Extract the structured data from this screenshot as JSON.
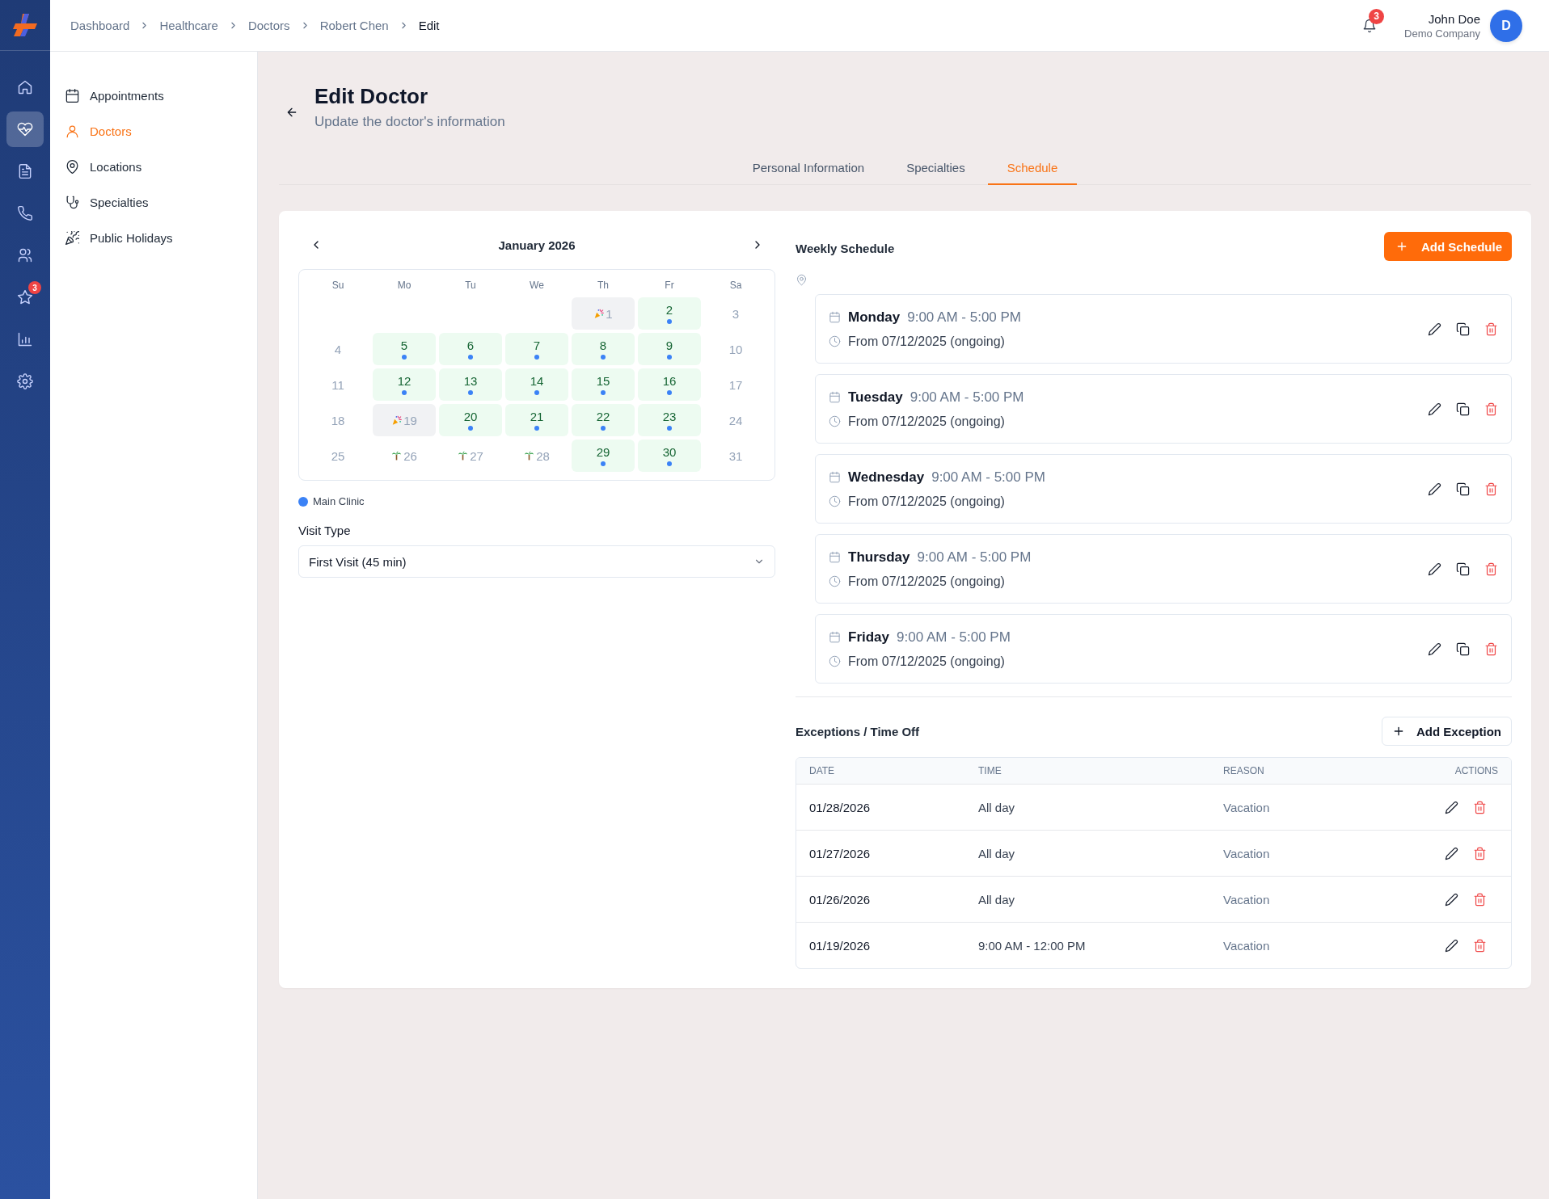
{
  "breadcrumbs": [
    {
      "label": "Dashboard",
      "current": false
    },
    {
      "label": "Healthcare",
      "current": false
    },
    {
      "label": "Doctors",
      "current": false
    },
    {
      "label": "Robert Chen",
      "current": false
    },
    {
      "label": "Edit",
      "current": true
    }
  ],
  "notifications": {
    "count": "3"
  },
  "user": {
    "name": "John Doe",
    "company": "Demo Company",
    "initial": "D"
  },
  "rail": [
    {
      "kind": "home",
      "selected": false
    },
    {
      "kind": "heart",
      "selected": true
    },
    {
      "kind": "document",
      "selected": false
    },
    {
      "kind": "phone",
      "selected": false
    },
    {
      "kind": "users",
      "selected": false
    },
    {
      "kind": "star",
      "selected": false,
      "badge": "3"
    },
    {
      "kind": "chart",
      "selected": false
    },
    {
      "kind": "settings",
      "selected": false
    }
  ],
  "sidebar": {
    "items": [
      {
        "label": "Appointments",
        "kind": "calendar",
        "selected": false
      },
      {
        "label": "Doctors",
        "kind": "person",
        "selected": true
      },
      {
        "label": "Locations",
        "kind": "pin",
        "selected": false
      },
      {
        "label": "Specialties",
        "kind": "stethoscope",
        "selected": false
      },
      {
        "label": "Public Holidays",
        "kind": "popper",
        "selected": false
      }
    ]
  },
  "page": {
    "title": "Edit Doctor",
    "subtitle": "Update the doctor's information"
  },
  "tabs": [
    {
      "label": "Personal Information",
      "selected": false
    },
    {
      "label": "Specialties",
      "selected": false
    },
    {
      "label": "Schedule",
      "selected": true
    }
  ],
  "calendar": {
    "month": "January 2026",
    "weekdays": [
      "Su",
      "Mo",
      "Tu",
      "We",
      "Th",
      "Fr",
      "Sa"
    ],
    "weeks": [
      [
        {
          "day": "1",
          "kind": "holiday"
        },
        {
          "day": "2",
          "kind": "available"
        },
        {
          "day": "3",
          "kind": "off"
        }
      ],
      [
        {
          "day": "4",
          "kind": "off"
        },
        {
          "day": "5",
          "kind": "available"
        },
        {
          "day": "6",
          "kind": "available"
        },
        {
          "day": "7",
          "kind": "available"
        },
        {
          "day": "8",
          "kind": "available"
        },
        {
          "day": "9",
          "kind": "available"
        },
        {
          "day": "10",
          "kind": "off"
        }
      ],
      [
        {
          "day": "11",
          "kind": "off"
        },
        {
          "day": "12",
          "kind": "available"
        },
        {
          "day": "13",
          "kind": "available"
        },
        {
          "day": "14",
          "kind": "available"
        },
        {
          "day": "15",
          "kind": "available"
        },
        {
          "day": "16",
          "kind": "available"
        },
        {
          "day": "17",
          "kind": "off"
        }
      ],
      [
        {
          "day": "18",
          "kind": "off"
        },
        {
          "day": "19",
          "kind": "holiday"
        },
        {
          "day": "20",
          "kind": "available"
        },
        {
          "day": "21",
          "kind": "available"
        },
        {
          "day": "22",
          "kind": "available"
        },
        {
          "day": "23",
          "kind": "available"
        },
        {
          "day": "24",
          "kind": "off"
        }
      ],
      [
        {
          "day": "25",
          "kind": "off"
        },
        {
          "day": "26",
          "kind": "vacation"
        },
        {
          "day": "27",
          "kind": "vacation"
        },
        {
          "day": "28",
          "kind": "vacation"
        },
        {
          "day": "29",
          "kind": "available"
        },
        {
          "day": "30",
          "kind": "available"
        },
        {
          "day": "31",
          "kind": "off"
        }
      ]
    ]
  },
  "legend": [
    {
      "label": "Main Clinic",
      "color": "#3b82f6"
    }
  ],
  "visit_type": {
    "label": "Visit Type",
    "value": "First Visit (45 min)"
  },
  "weekly_schedule": {
    "title": "Weekly Schedule",
    "add_button": "Add Schedule",
    "entries": [
      {
        "day": "Monday",
        "time": "9:00 AM - 5:00 PM",
        "period": "From 07/12/2025 (ongoing)"
      },
      {
        "day": "Tuesday",
        "time": "9:00 AM - 5:00 PM",
        "period": "From 07/12/2025 (ongoing)"
      },
      {
        "day": "Wednesday",
        "time": "9:00 AM - 5:00 PM",
        "period": "From 07/12/2025 (ongoing)"
      },
      {
        "day": "Thursday",
        "time": "9:00 AM - 5:00 PM",
        "period": "From 07/12/2025 (ongoing)"
      },
      {
        "day": "Friday",
        "time": "9:00 AM - 5:00 PM",
        "period": "From 07/12/2025 (ongoing)"
      }
    ]
  },
  "exceptions": {
    "title": "Exceptions / Time Off",
    "add_button": "Add Exception",
    "columns": [
      "DATE",
      "TIME",
      "REASON",
      "ACTIONS"
    ],
    "rows": [
      {
        "date": "01/28/2026",
        "time": "All day",
        "reason": "Vacation"
      },
      {
        "date": "01/27/2026",
        "time": "All day",
        "reason": "Vacation"
      },
      {
        "date": "01/26/2026",
        "time": "All day",
        "reason": "Vacation"
      },
      {
        "date": "01/19/2026",
        "time": "9:00 AM - 12:00 PM",
        "reason": "Vacation"
      }
    ]
  }
}
